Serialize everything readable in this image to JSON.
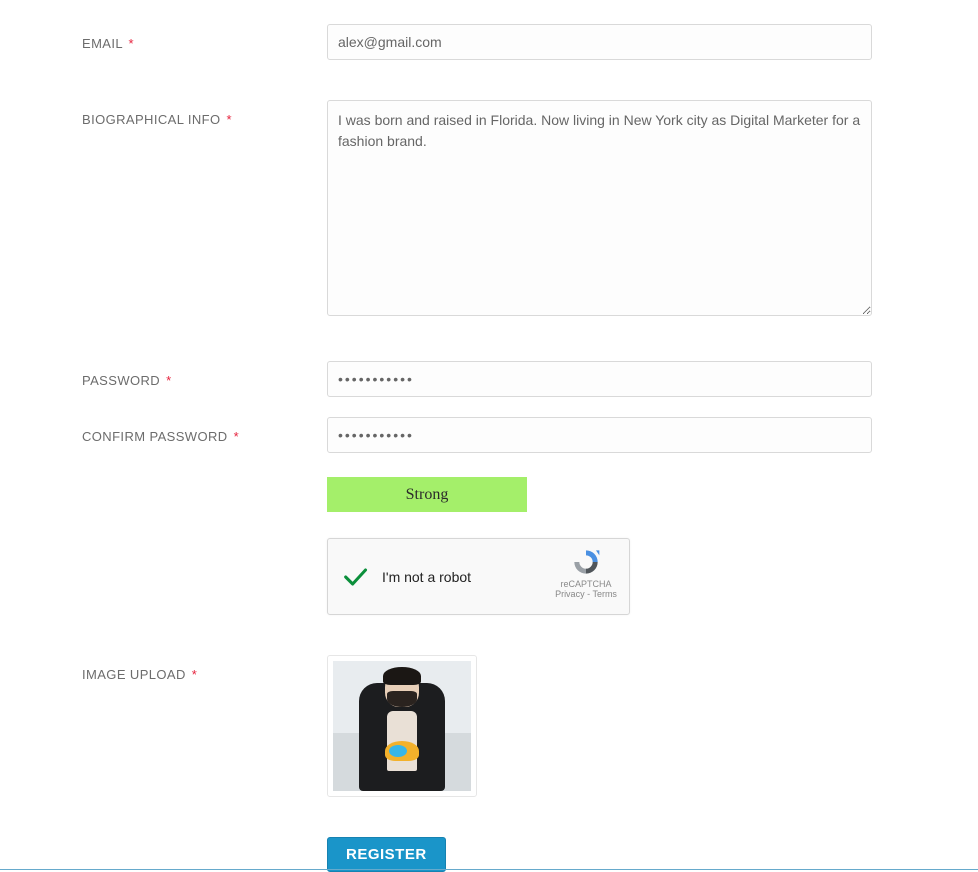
{
  "form": {
    "email": {
      "label": "EMAIL",
      "value": "alex@gmail.com"
    },
    "bio": {
      "label": "BIOGRAPHICAL INFO",
      "value": "I was born and raised in Florida. Now living in New York city as Digital Marketer for a fashion brand."
    },
    "password": {
      "label": "PASSWORD",
      "value": "•••••••••••"
    },
    "confirm": {
      "label": "CONFIRM PASSWORD",
      "value": "•••••••••••"
    },
    "strength": "Strong",
    "captcha": {
      "text": "I'm not a robot",
      "brand": "reCAPTCHA",
      "privacy": "Privacy",
      "terms": "Terms"
    },
    "image_upload": {
      "label": "IMAGE UPLOAD"
    },
    "submit": "REGISTER",
    "required_marker": "*"
  }
}
